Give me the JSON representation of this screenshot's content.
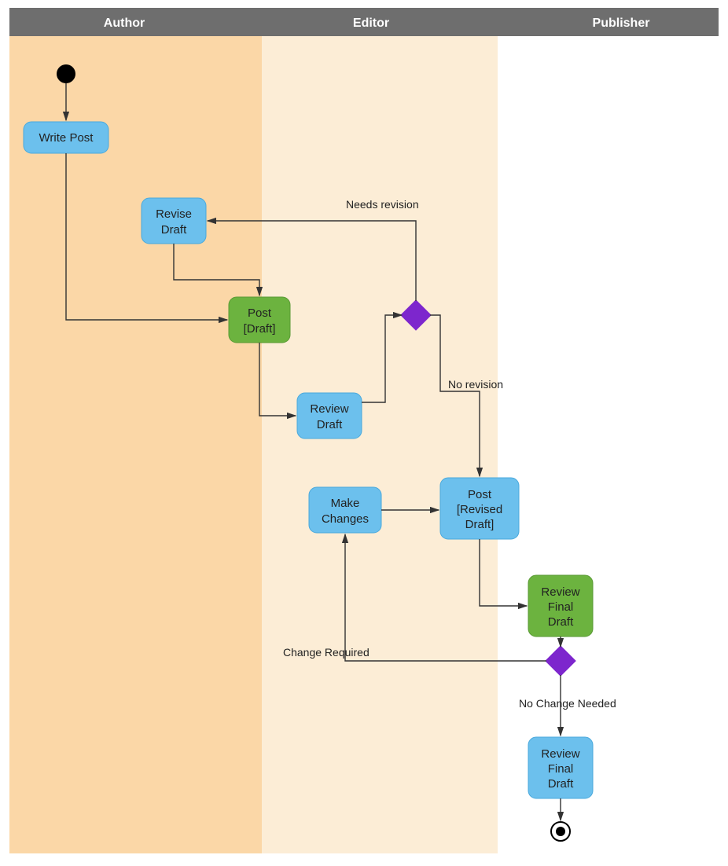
{
  "swimlanes": {
    "author": "Author",
    "editor": "Editor",
    "publisher": "Publisher"
  },
  "nodes": {
    "write_post": "Write Post",
    "revise_draft_l1": "Revise",
    "revise_draft_l2": "Draft",
    "post_draft_l1": "Post",
    "post_draft_l2": "[Draft]",
    "review_draft_l1": "Review",
    "review_draft_l2": "Draft",
    "make_changes_l1": "Make",
    "make_changes_l2": "Changes",
    "post_revised_l1": "Post",
    "post_revised_l2": "[Revised",
    "post_revised_l3": "Draft]",
    "review_final_l1": "Review",
    "review_final_l2": "Final",
    "review_final_l3": "Draft",
    "review_final2_l1": "Review",
    "review_final2_l2": "Final",
    "review_final2_l3": "Draft"
  },
  "edges": {
    "needs_revision": "Needs revision",
    "no_revision": "No revision",
    "change_required": "Change Required",
    "no_change_needed": "No Change Needed"
  },
  "chart_data": {
    "type": "activity_diagram_swimlane",
    "lanes": [
      "Author",
      "Editor",
      "Publisher"
    ],
    "nodes": [
      {
        "id": "start",
        "type": "initial",
        "lane": "Author"
      },
      {
        "id": "write_post",
        "type": "action",
        "lane": "Author",
        "label": "Write Post",
        "color": "blue"
      },
      {
        "id": "revise_draft",
        "type": "action",
        "lane": "Author",
        "label": "Revise Draft",
        "color": "blue"
      },
      {
        "id": "post_draft",
        "type": "object",
        "lane": "Author",
        "label": "Post [Draft]",
        "color": "green"
      },
      {
        "id": "review_draft",
        "type": "action",
        "lane": "Editor",
        "label": "Review Draft",
        "color": "blue"
      },
      {
        "id": "decision1",
        "type": "decision",
        "lane": "Editor"
      },
      {
        "id": "make_changes",
        "type": "action",
        "lane": "Editor",
        "label": "Make Changes",
        "color": "blue"
      },
      {
        "id": "post_revised",
        "type": "object",
        "lane": "Editor",
        "label": "Post [Revised Draft]",
        "color": "blue"
      },
      {
        "id": "review_final",
        "type": "action",
        "lane": "Publisher",
        "label": "Review Final Draft",
        "color": "green"
      },
      {
        "id": "decision2",
        "type": "decision",
        "lane": "Publisher"
      },
      {
        "id": "review_final2",
        "type": "action",
        "lane": "Publisher",
        "label": "Review Final Draft",
        "color": "blue"
      },
      {
        "id": "end",
        "type": "final",
        "lane": "Publisher"
      }
    ],
    "edges": [
      {
        "from": "start",
        "to": "write_post"
      },
      {
        "from": "write_post",
        "to": "post_draft"
      },
      {
        "from": "revise_draft",
        "to": "post_draft"
      },
      {
        "from": "post_draft",
        "to": "review_draft"
      },
      {
        "from": "review_draft",
        "to": "decision1"
      },
      {
        "from": "decision1",
        "to": "revise_draft",
        "label": "Needs revision"
      },
      {
        "from": "decision1",
        "to": "post_revised",
        "label": "No revision"
      },
      {
        "from": "make_changes",
        "to": "post_revised"
      },
      {
        "from": "post_revised",
        "to": "review_final"
      },
      {
        "from": "review_final",
        "to": "decision2"
      },
      {
        "from": "decision2",
        "to": "make_changes",
        "label": "Change Required"
      },
      {
        "from": "decision2",
        "to": "review_final2",
        "label": "No Change Needed"
      },
      {
        "from": "review_final2",
        "to": "end"
      }
    ]
  }
}
